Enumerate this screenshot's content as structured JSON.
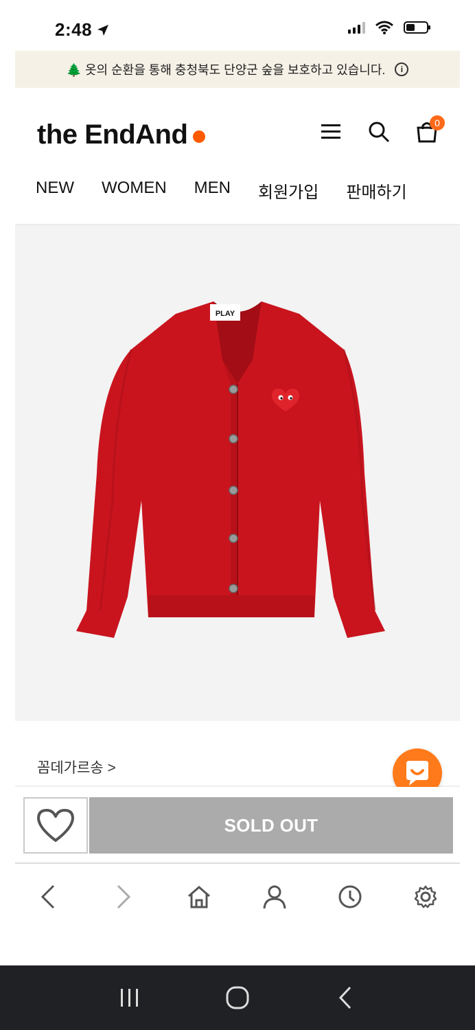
{
  "status_bar": {
    "time": "2:48"
  },
  "notice": {
    "text": "🌲 옷의 순환을 통해 충청북도 단양군 숲을 보호하고 있습니다."
  },
  "header": {
    "logo": "the EndAnd",
    "cart_count": "0",
    "nav": [
      "NEW",
      "WOMEN",
      "MEN",
      "회원가입",
      "판매하기"
    ]
  },
  "product": {
    "image_label": "PLAY",
    "brand": "꼼데가르송",
    "brand_arrow": ">",
    "status": "SOLD OUT"
  },
  "colors": {
    "accent": "#ff5a00",
    "soldout": "#ababab",
    "sweater": "#c9141e"
  }
}
